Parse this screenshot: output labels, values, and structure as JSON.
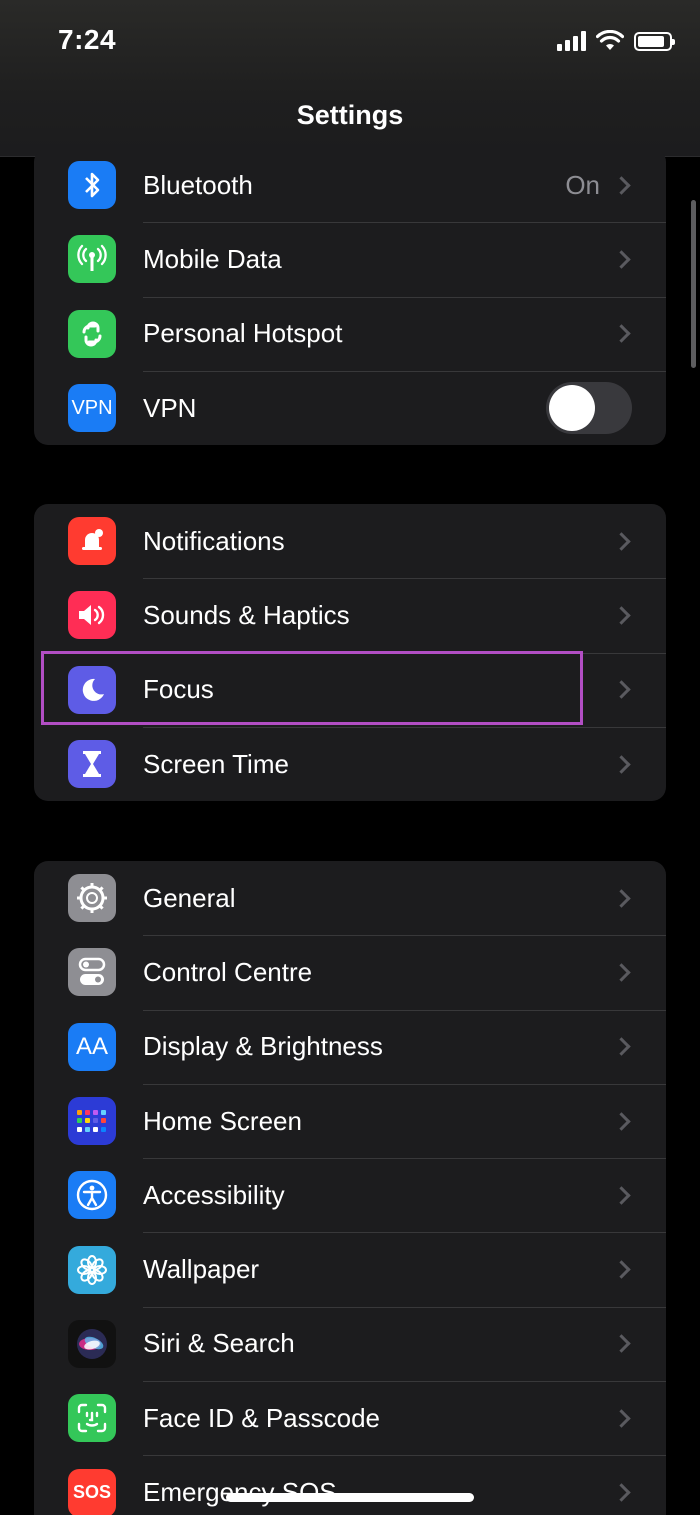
{
  "status": {
    "time": "7:24"
  },
  "header": {
    "title": "Settings"
  },
  "groups": [
    {
      "items": [
        {
          "label": "Bluetooth",
          "value": "On",
          "icon": "bluetooth-icon",
          "color": "#1a7cf5"
        },
        {
          "label": "Mobile Data",
          "icon": "antenna-icon",
          "color": "#34c759"
        },
        {
          "label": "Personal Hotspot",
          "icon": "hotspot-icon",
          "color": "#34c759"
        },
        {
          "label": "VPN",
          "icon_text": "VPN",
          "icon": "vpn-icon",
          "color": "#1a7cf5",
          "toggle": false
        }
      ]
    },
    {
      "items": [
        {
          "label": "Notifications",
          "icon": "notifications-icon",
          "color": "#ff3b30"
        },
        {
          "label": "Sounds & Haptics",
          "icon": "speaker-icon",
          "color": "#ff2d55"
        },
        {
          "label": "Focus",
          "icon": "moon-icon",
          "color": "#5e5ce6"
        },
        {
          "label": "Screen Time",
          "icon": "hourglass-icon",
          "color": "#5e5ce6"
        }
      ]
    },
    {
      "items": [
        {
          "label": "General",
          "icon": "gear-icon",
          "color": "#8e8e93"
        },
        {
          "label": "Control Centre",
          "icon": "switches-icon",
          "color": "#8e8e93"
        },
        {
          "label": "Display & Brightness",
          "icon_text": "AA",
          "icon": "display-icon",
          "color": "#1a7cf5"
        },
        {
          "label": "Home Screen",
          "icon": "home-screen-icon",
          "color": "#2c3bd6"
        },
        {
          "label": "Accessibility",
          "icon": "accessibility-icon",
          "color": "#1a7cf5"
        },
        {
          "label": "Wallpaper",
          "icon": "flower-icon",
          "color": "#34aadc"
        },
        {
          "label": "Siri & Search",
          "icon": "siri-icon",
          "color": "#222"
        },
        {
          "label": "Face ID & Passcode",
          "icon": "face-id-icon",
          "color": "#34c759"
        },
        {
          "label": "Emergency SOS",
          "icon_text": "SOS",
          "icon": "sos-icon",
          "color": "#ff3b30"
        }
      ]
    }
  ]
}
